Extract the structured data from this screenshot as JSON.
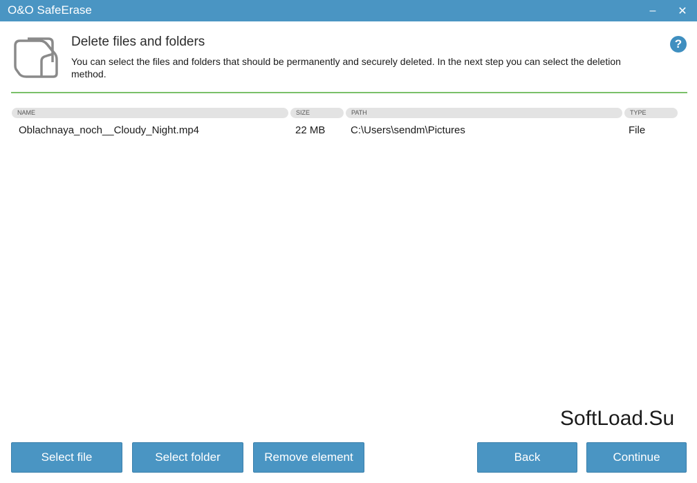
{
  "window": {
    "title": "O&O SafeErase"
  },
  "header": {
    "title": "Delete files and folders",
    "description": "You can select the files and folders that should be permanently and securely deleted. In the next step you can select the deletion method."
  },
  "table": {
    "columns": {
      "name": "NAME",
      "size": "SIZE",
      "path": "PATH",
      "type": "TYPE"
    },
    "rows": [
      {
        "name": "Oblachnaya_noch__Cloudy_Night.mp4",
        "size": "22 MB",
        "path": "C:\\Users\\sendm\\Pictures",
        "type": "File"
      }
    ]
  },
  "watermark": "SoftLoad.Su",
  "buttons": {
    "select_file": "Select file",
    "select_folder": "Select folder",
    "remove_element": "Remove element",
    "back": "Back",
    "continue": "Continue"
  },
  "icons": {
    "minimize": "minimize-icon",
    "close": "close-icon",
    "help": "help-icon",
    "header": "folders-icon"
  },
  "colors": {
    "accent": "#4a95c3",
    "divider": "#7ac068"
  }
}
